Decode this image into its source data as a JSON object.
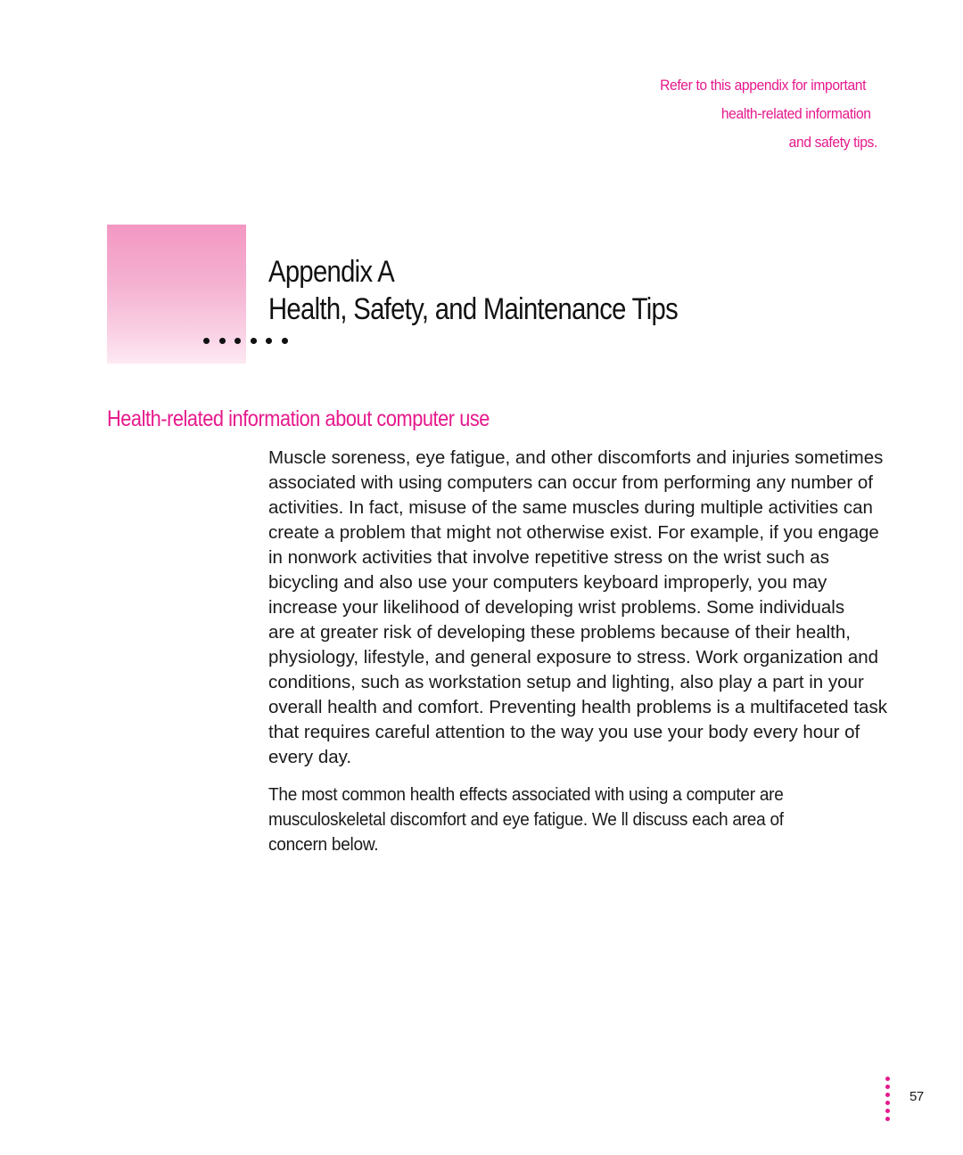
{
  "margin_note": {
    "lines": [
      "Refer to this appendix for important",
      "health-related information",
      "and safety tips."
    ]
  },
  "chapter": {
    "label": "Appendix A",
    "title": "Health, Safety, and Maintenance Tips",
    "accent_color": "#f397c2"
  },
  "section": {
    "heading": "Health-related information about computer use",
    "heading_color": "#e6198c"
  },
  "body": {
    "paragraph_1": [
      "Muscle soreness, eye fatigue, and other discomforts and injuries sometimes",
      "associated with using computers can occur from performing any number of",
      "activities. In fact, misuse of the same muscles during multiple activities can",
      "create a problem that might not otherwise exist. For example, if you engage",
      "in nonwork activities that involve repetitive stress on the wrist such as",
      "bicycling and also use your computers keyboard improperly, you may",
      "increase your likelihood of developing wrist problems. Some individuals",
      "are at greater risk of developing these problems because of their health,",
      "physiology, lifestyle, and general exposure to stress. Work organization and",
      "conditions, such as workstation setup and lighting, also play a part in your",
      "overall health and comfort. Preventing health problems is a multifaceted task",
      "that requires careful attention to the way you use your body every hour of",
      "every day."
    ],
    "paragraph_2": [
      "The most common health effects associated with using a computer are",
      "musculoskeletal discomfort and eye fatigue. We ll discuss each area of",
      "concern below."
    ]
  },
  "footer": {
    "page_number": "57",
    "dot_color": "#e6198c"
  }
}
